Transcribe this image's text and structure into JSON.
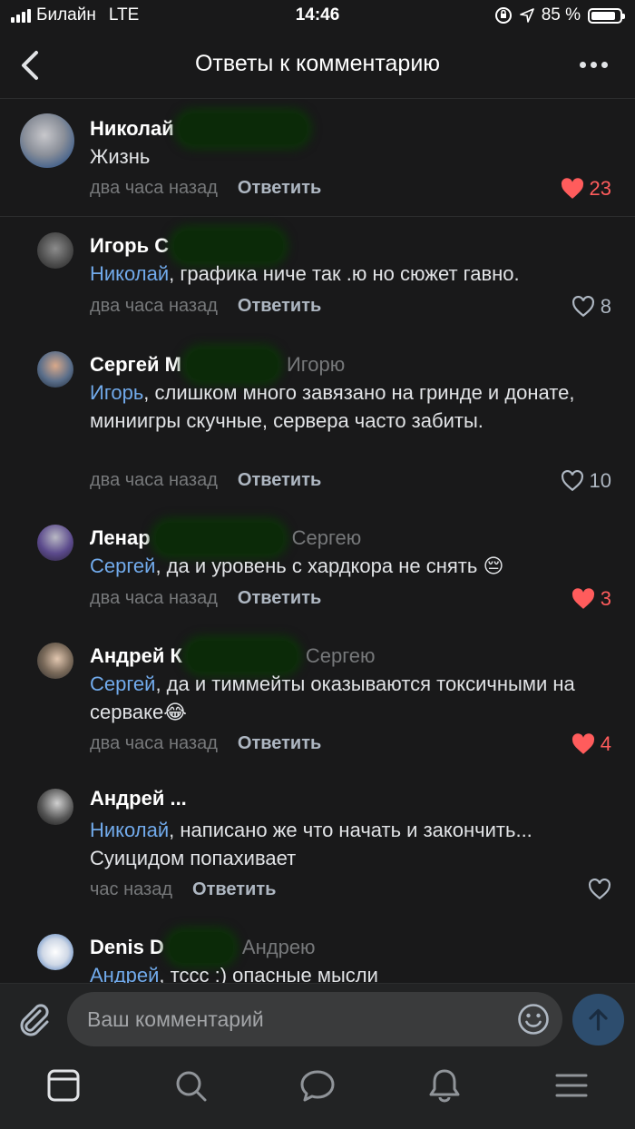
{
  "status_bar": {
    "carrier": "Билайн",
    "network": "LTE",
    "time": "14:46",
    "battery_percent": "85 %",
    "battery_level": 0.85
  },
  "header": {
    "title": "Ответы к комментарию",
    "back_icon": "chevron-left-icon",
    "more_icon": "more-horizontal-icon"
  },
  "comments": [
    {
      "name": "Николай",
      "reply_to": "",
      "mention": "",
      "text": "Жизнь",
      "time": "два часа назад",
      "reply_label": "Ответить",
      "likes": "23",
      "liked": true
    },
    {
      "name": "Игорь С",
      "reply_to": "",
      "mention": "Николай",
      "text": ", графика ниче так .ю но сюжет гавно.",
      "time": "два часа назад",
      "reply_label": "Ответить",
      "likes": "8",
      "liked": false
    },
    {
      "name": "Сергей М",
      "reply_to": "Игорю",
      "mention": "Игорь",
      "text": ", слишком много завязано на гринде и донате, миниигры скучные, сервера часто забиты.",
      "time": "два часа назад",
      "reply_label": "Ответить",
      "likes": "10",
      "liked": false
    },
    {
      "name": "Ленар",
      "reply_to": "Сергею",
      "mention": "Сергей",
      "text": ", да и уровень с хардкора не снять 😔",
      "time": "два часа назад",
      "reply_label": "Ответить",
      "likes": "3",
      "liked": true
    },
    {
      "name": "Андрей К",
      "reply_to": "Сергею",
      "mention": "Сергей",
      "text": ", да и тиммейты оказываются токсичными на серваке😂",
      "time": "два часа назад",
      "reply_label": "Ответить",
      "likes": "4",
      "liked": true
    },
    {
      "name": "Андрей ...",
      "reply_to": "",
      "mention": "Николай",
      "text": ", написано же что начать и закончить... Суицидом попахивает",
      "time": "час назад",
      "reply_label": "Ответить",
      "likes": "",
      "liked": false
    },
    {
      "name": "Denis D",
      "reply_to": "Андрею",
      "mention": "Андрей",
      "text": ", тссс :) опасные мысли",
      "time": "",
      "reply_label": "",
      "likes": "",
      "liked": false
    }
  ],
  "composer": {
    "placeholder": "Ваш комментарий",
    "attach_icon": "paperclip-icon",
    "emoji_icon": "smile-icon",
    "send_icon": "arrow-up-icon"
  },
  "tabbar": {
    "items": [
      "news-icon",
      "search-icon",
      "messages-icon",
      "notifications-icon",
      "menu-icon"
    ]
  },
  "colors": {
    "background": "#19191a",
    "mention": "#71aaeb",
    "like_active": "#ff5c5c",
    "muted": "#76787a"
  }
}
